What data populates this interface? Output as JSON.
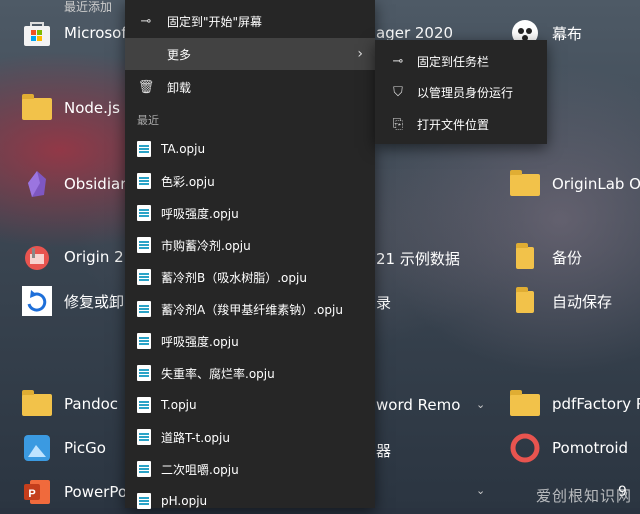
{
  "left_apps": [
    {
      "label": "最近添加",
      "icon": "recent-icon"
    },
    {
      "label": "Microsoft Store",
      "icon": "store-icon"
    },
    {
      "label": "Node.js",
      "icon": "folder-icon"
    },
    {
      "label": "Obsidian",
      "icon": "obsidian-icon"
    },
    {
      "label": "Origin 2",
      "icon": "origin-icon"
    },
    {
      "label": "修复或卸",
      "icon": "repair-icon"
    },
    {
      "label": "Pandoc",
      "icon": "folder-icon"
    },
    {
      "label": "PicGo",
      "icon": "picgo-icon"
    },
    {
      "label": "PowerPo",
      "icon": "powerpoint-icon"
    }
  ],
  "middle_partial": [
    "ager 2020",
    "21 示例数据",
    "录",
    "word Remo",
    "器"
  ],
  "right_apps": [
    {
      "label": "幕布",
      "icon": "mubu-icon"
    },
    {
      "label": "OriginLab O",
      "icon": "folder-icon"
    },
    {
      "label": "备份",
      "icon": "folder-icon"
    },
    {
      "label": "自动保存",
      "icon": "folder-icon"
    },
    {
      "label": "pdfFactory P",
      "icon": "folder-icon"
    },
    {
      "label": "Pomotroid",
      "icon": "pomotroid-icon"
    },
    {
      "label": "9",
      "icon": ""
    }
  ],
  "context_menu": {
    "pin_start": "固定到\"开始\"屏幕",
    "more": "更多",
    "uninstall": "卸载",
    "recent_header": "最近",
    "recent_files": [
      "TA.opju",
      "色彩.opju",
      "呼吸强度.opju",
      "市购蓄冷剂.opju",
      "蓄冷剂B（吸水树脂）.opju",
      "蓄冷剂A（羧甲基纤维素钠）.opju",
      "呼吸强度.opju",
      "失重率、腐烂率.opju",
      "T.opju",
      "道路T-t.opju",
      "二次咀嚼.opju",
      "pH.opju"
    ]
  },
  "submenu": {
    "pin_taskbar": "固定到任务栏",
    "run_admin": "以管理员身份运行",
    "open_location": "打开文件位置"
  },
  "watermark": "爱创根知识网"
}
